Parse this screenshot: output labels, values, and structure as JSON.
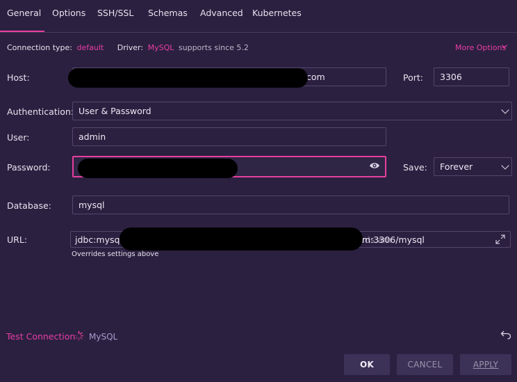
{
  "tabs": [
    {
      "label": "General"
    },
    {
      "label": "Options"
    },
    {
      "label": "SSH/SSL"
    },
    {
      "label": "Schemas"
    },
    {
      "label": "Advanced"
    },
    {
      "label": "Kubernetes"
    }
  ],
  "info": {
    "connection_type_label": "Connection type:",
    "connection_type_value": "default",
    "driver_label": "Driver:",
    "driver_value": "MySQL",
    "driver_note": "supports since 5.2",
    "more_options": "More Options"
  },
  "host": {
    "label": "Host:",
    "value_suffix": "com"
  },
  "port": {
    "label": "Port:",
    "value": "3306"
  },
  "authentication": {
    "label": "Authentication:",
    "value": "User & Password"
  },
  "user": {
    "label": "User:",
    "value": "admin"
  },
  "password": {
    "label": "Password:"
  },
  "save": {
    "label": "Save:",
    "value": "Forever"
  },
  "database": {
    "label": "Database:",
    "value": "mysql"
  },
  "url": {
    "label": "URL:",
    "value_start": "jdbc:mysql:/",
    "value_end": "m:3306/mysql",
    "hint": "Overrides settings above"
  },
  "footer": {
    "test_connection": "Test Connection",
    "driver_name": "MySQL",
    "ok": "OK",
    "cancel": "CANCEL",
    "apply": "APPLY"
  },
  "colors": {
    "background": "#2b2040",
    "accent": "#e83f9e",
    "border": "#54476d"
  }
}
